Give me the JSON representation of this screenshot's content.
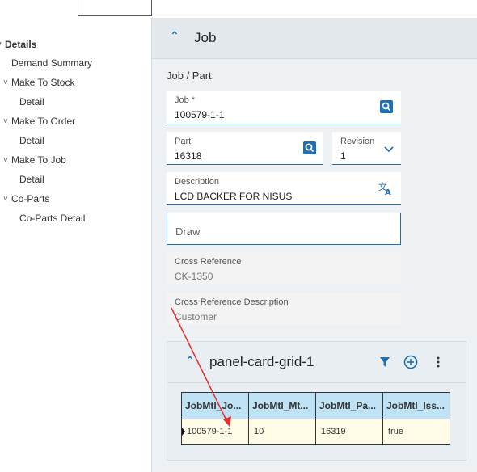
{
  "tree": {
    "items": [
      {
        "label": "Details",
        "chevron": "˅",
        "bold": true
      },
      {
        "label": "Demand Summary",
        "chevron": ""
      },
      {
        "label": "Make To Stock",
        "chevron": "˅"
      },
      {
        "label": "Detail",
        "chevron": ""
      },
      {
        "label": "Make To Order",
        "chevron": "˅"
      },
      {
        "label": "Detail",
        "chevron": ""
      },
      {
        "label": "Make To Job",
        "chevron": "˅"
      },
      {
        "label": "Detail",
        "chevron": ""
      },
      {
        "label": "Co-Parts",
        "chevron": "˅"
      },
      {
        "label": "Co-Parts Detail",
        "chevron": ""
      }
    ]
  },
  "panel": {
    "title": "Job",
    "section_label": "Job / Part",
    "job": {
      "label": "Job *",
      "value": "100579-1-1"
    },
    "part": {
      "label": "Part",
      "value": "16318"
    },
    "revision": {
      "label": "Revision",
      "value": "1"
    },
    "description": {
      "label": "Description",
      "value": "LCD BACKER FOR NISUS"
    },
    "draw": {
      "placeholder": "Draw"
    },
    "cross_reference": {
      "label": "Cross Reference",
      "value": "CK-1350"
    },
    "cross_reference_description": {
      "label": "Cross Reference Description",
      "value": "Customer"
    }
  },
  "grid_card": {
    "title": "panel-card-grid-1",
    "columns": [
      "JobMtl_Jo...",
      "JobMtl_Mt...",
      "JobMtl_Pa...",
      "JobMtl_Iss..."
    ],
    "rows": [
      [
        "100579-1-1",
        "10",
        "16319",
        "true"
      ]
    ]
  },
  "colors": {
    "accent": "#1f6fb2",
    "header_cell": "#bfe2f5",
    "row_cell": "#fffbe6",
    "annotation": "#e03030"
  }
}
